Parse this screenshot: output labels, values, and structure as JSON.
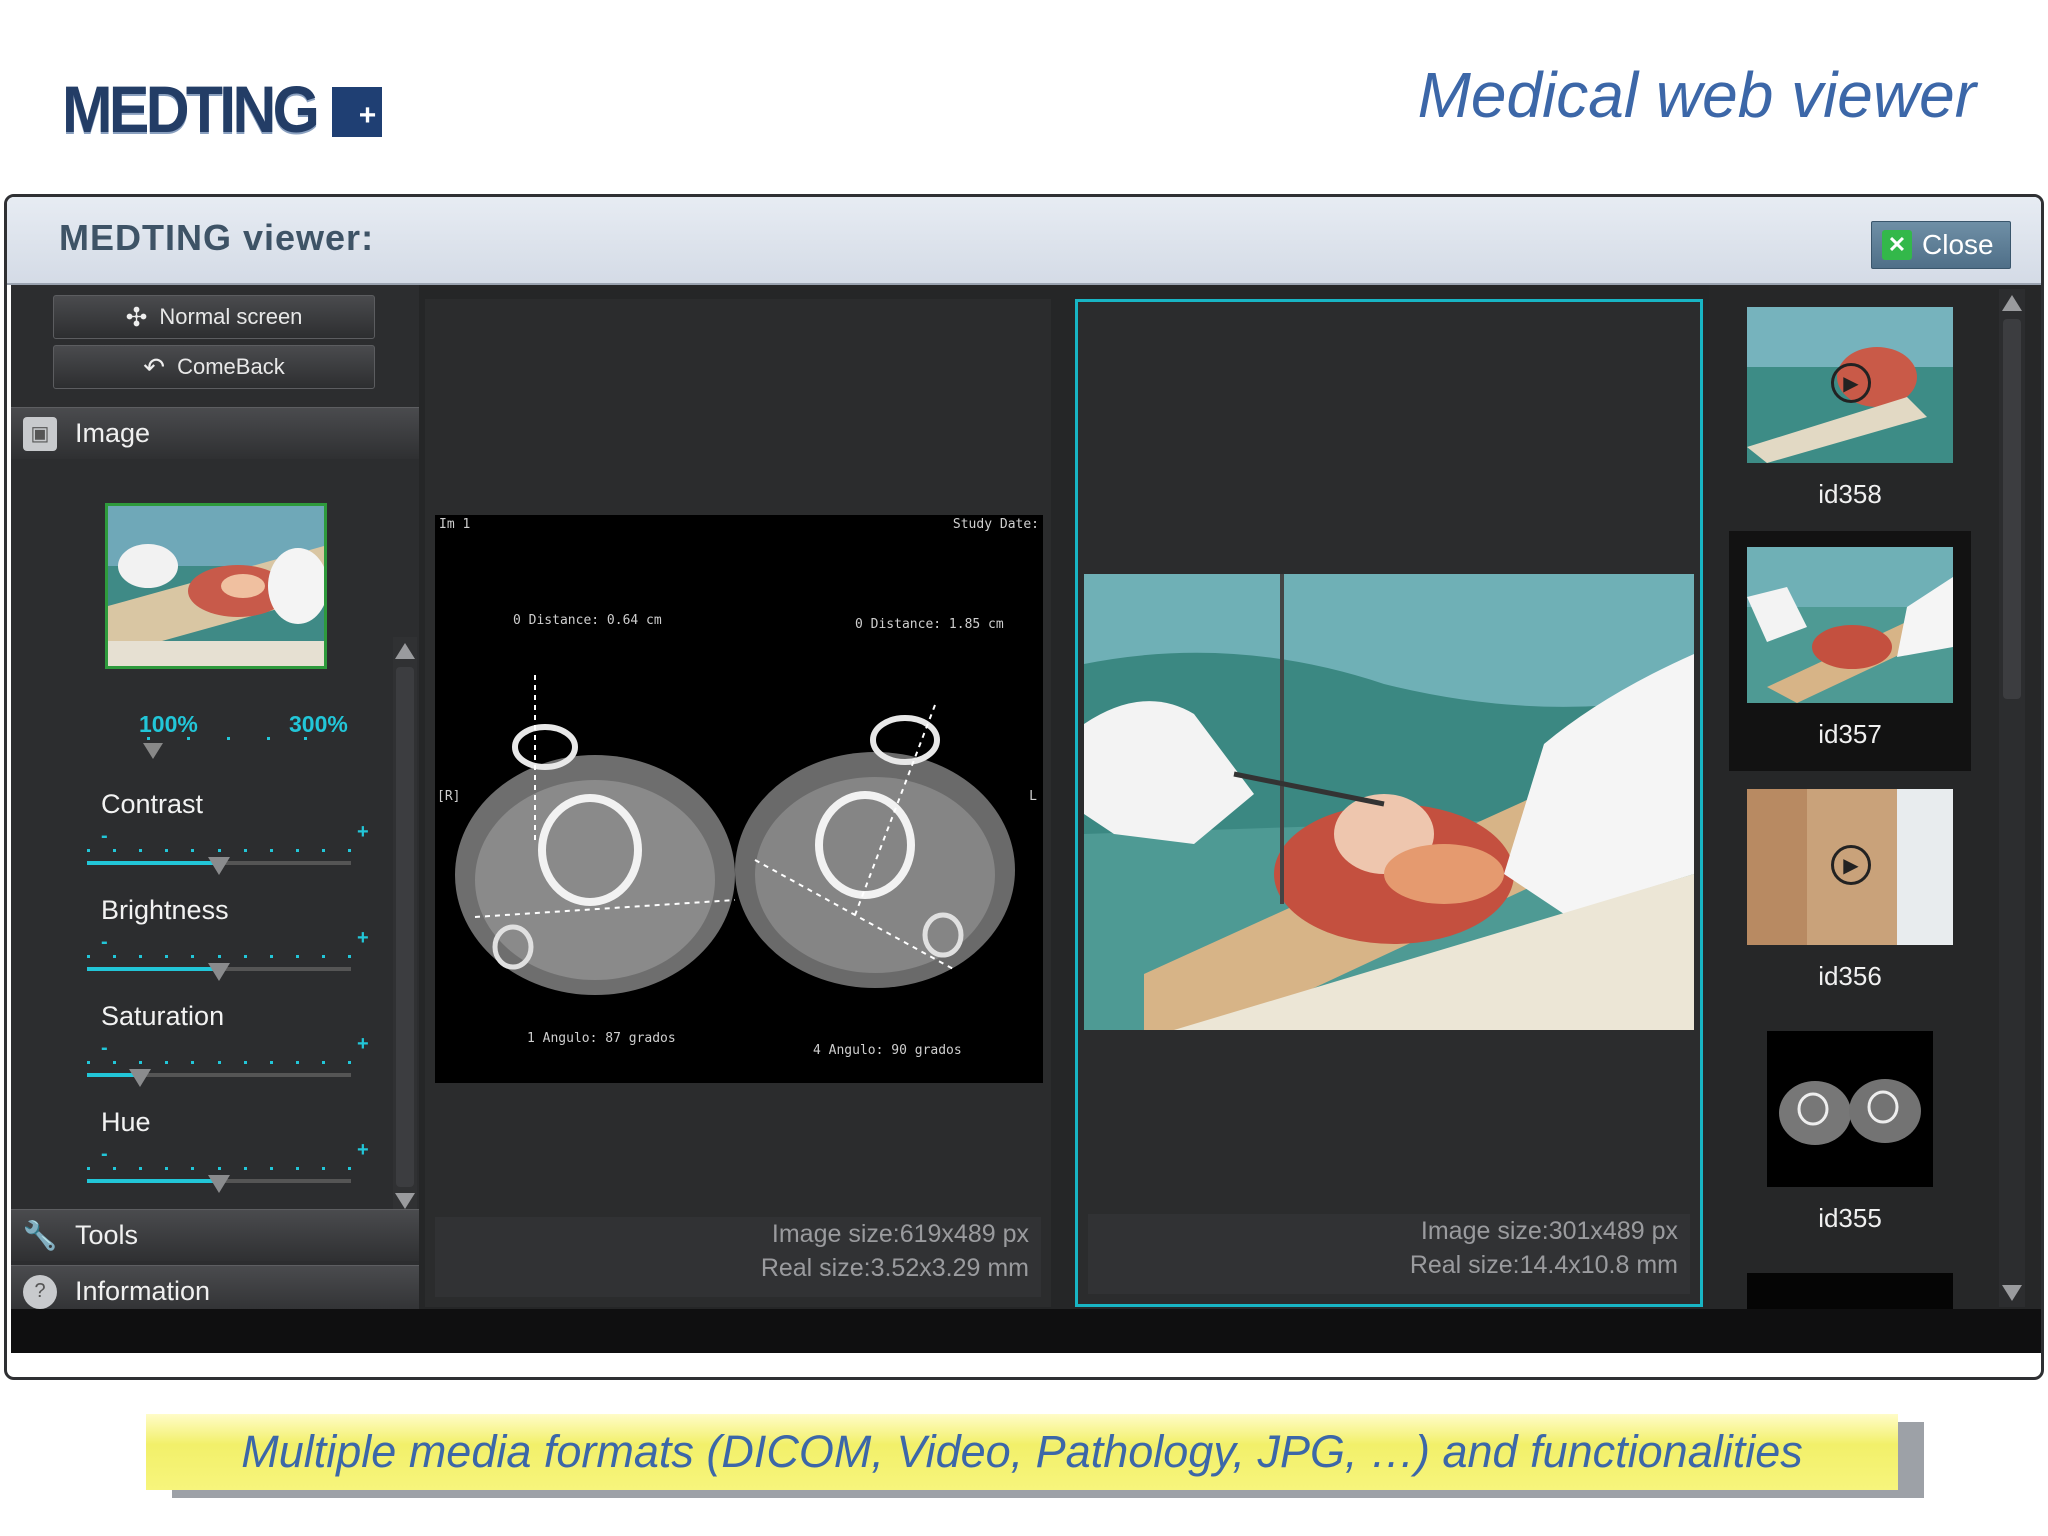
{
  "slide": {
    "logo_text": "MEDTING",
    "logo_plus": "+",
    "title": "Medical web viewer",
    "caption": "Multiple media formats (DICOM, Video, Pathology, JPG, …) and functionalities"
  },
  "viewer": {
    "title": "MEDTING viewer:",
    "close_label": "Close",
    "close_icon": "close-x-icon"
  },
  "left_panel": {
    "normal_screen_label": "Normal screen",
    "comeback_label": "ComeBack",
    "sections": {
      "image": "Image",
      "tools": "Tools",
      "information": "Information"
    },
    "zoom": {
      "min_label": "100%",
      "max_label": "300%",
      "value": 0
    },
    "adjustments": [
      {
        "label": "Contrast",
        "value": 0.5
      },
      {
        "label": "Brightness",
        "value": 0.5
      },
      {
        "label": "Saturation",
        "value": 0.2
      },
      {
        "label": "Hue",
        "value": 0.5
      }
    ],
    "minus_symbol": "-",
    "plus_symbol": "+"
  },
  "panels": {
    "dicom": {
      "image_size": "Image size:619x489 px",
      "real_size": "Real size:3.52x3.29 mm"
    },
    "photo": {
      "image_size": "Image size:301x489 px",
      "real_size": "Real size:14.4x10.8 mm"
    }
  },
  "thumbnails": [
    {
      "id": "id358",
      "type": "video",
      "selected": false
    },
    {
      "id": "id357",
      "type": "photo",
      "selected": true
    },
    {
      "id": "id356",
      "type": "video",
      "selected": false
    },
    {
      "id": "id355",
      "type": "dicom",
      "selected": false
    }
  ],
  "colors": {
    "accent": "#22c6d8",
    "selected_border": "#18b5c4",
    "title_blue": "#3c67a8",
    "caption_yellow": "#f2f06a"
  }
}
